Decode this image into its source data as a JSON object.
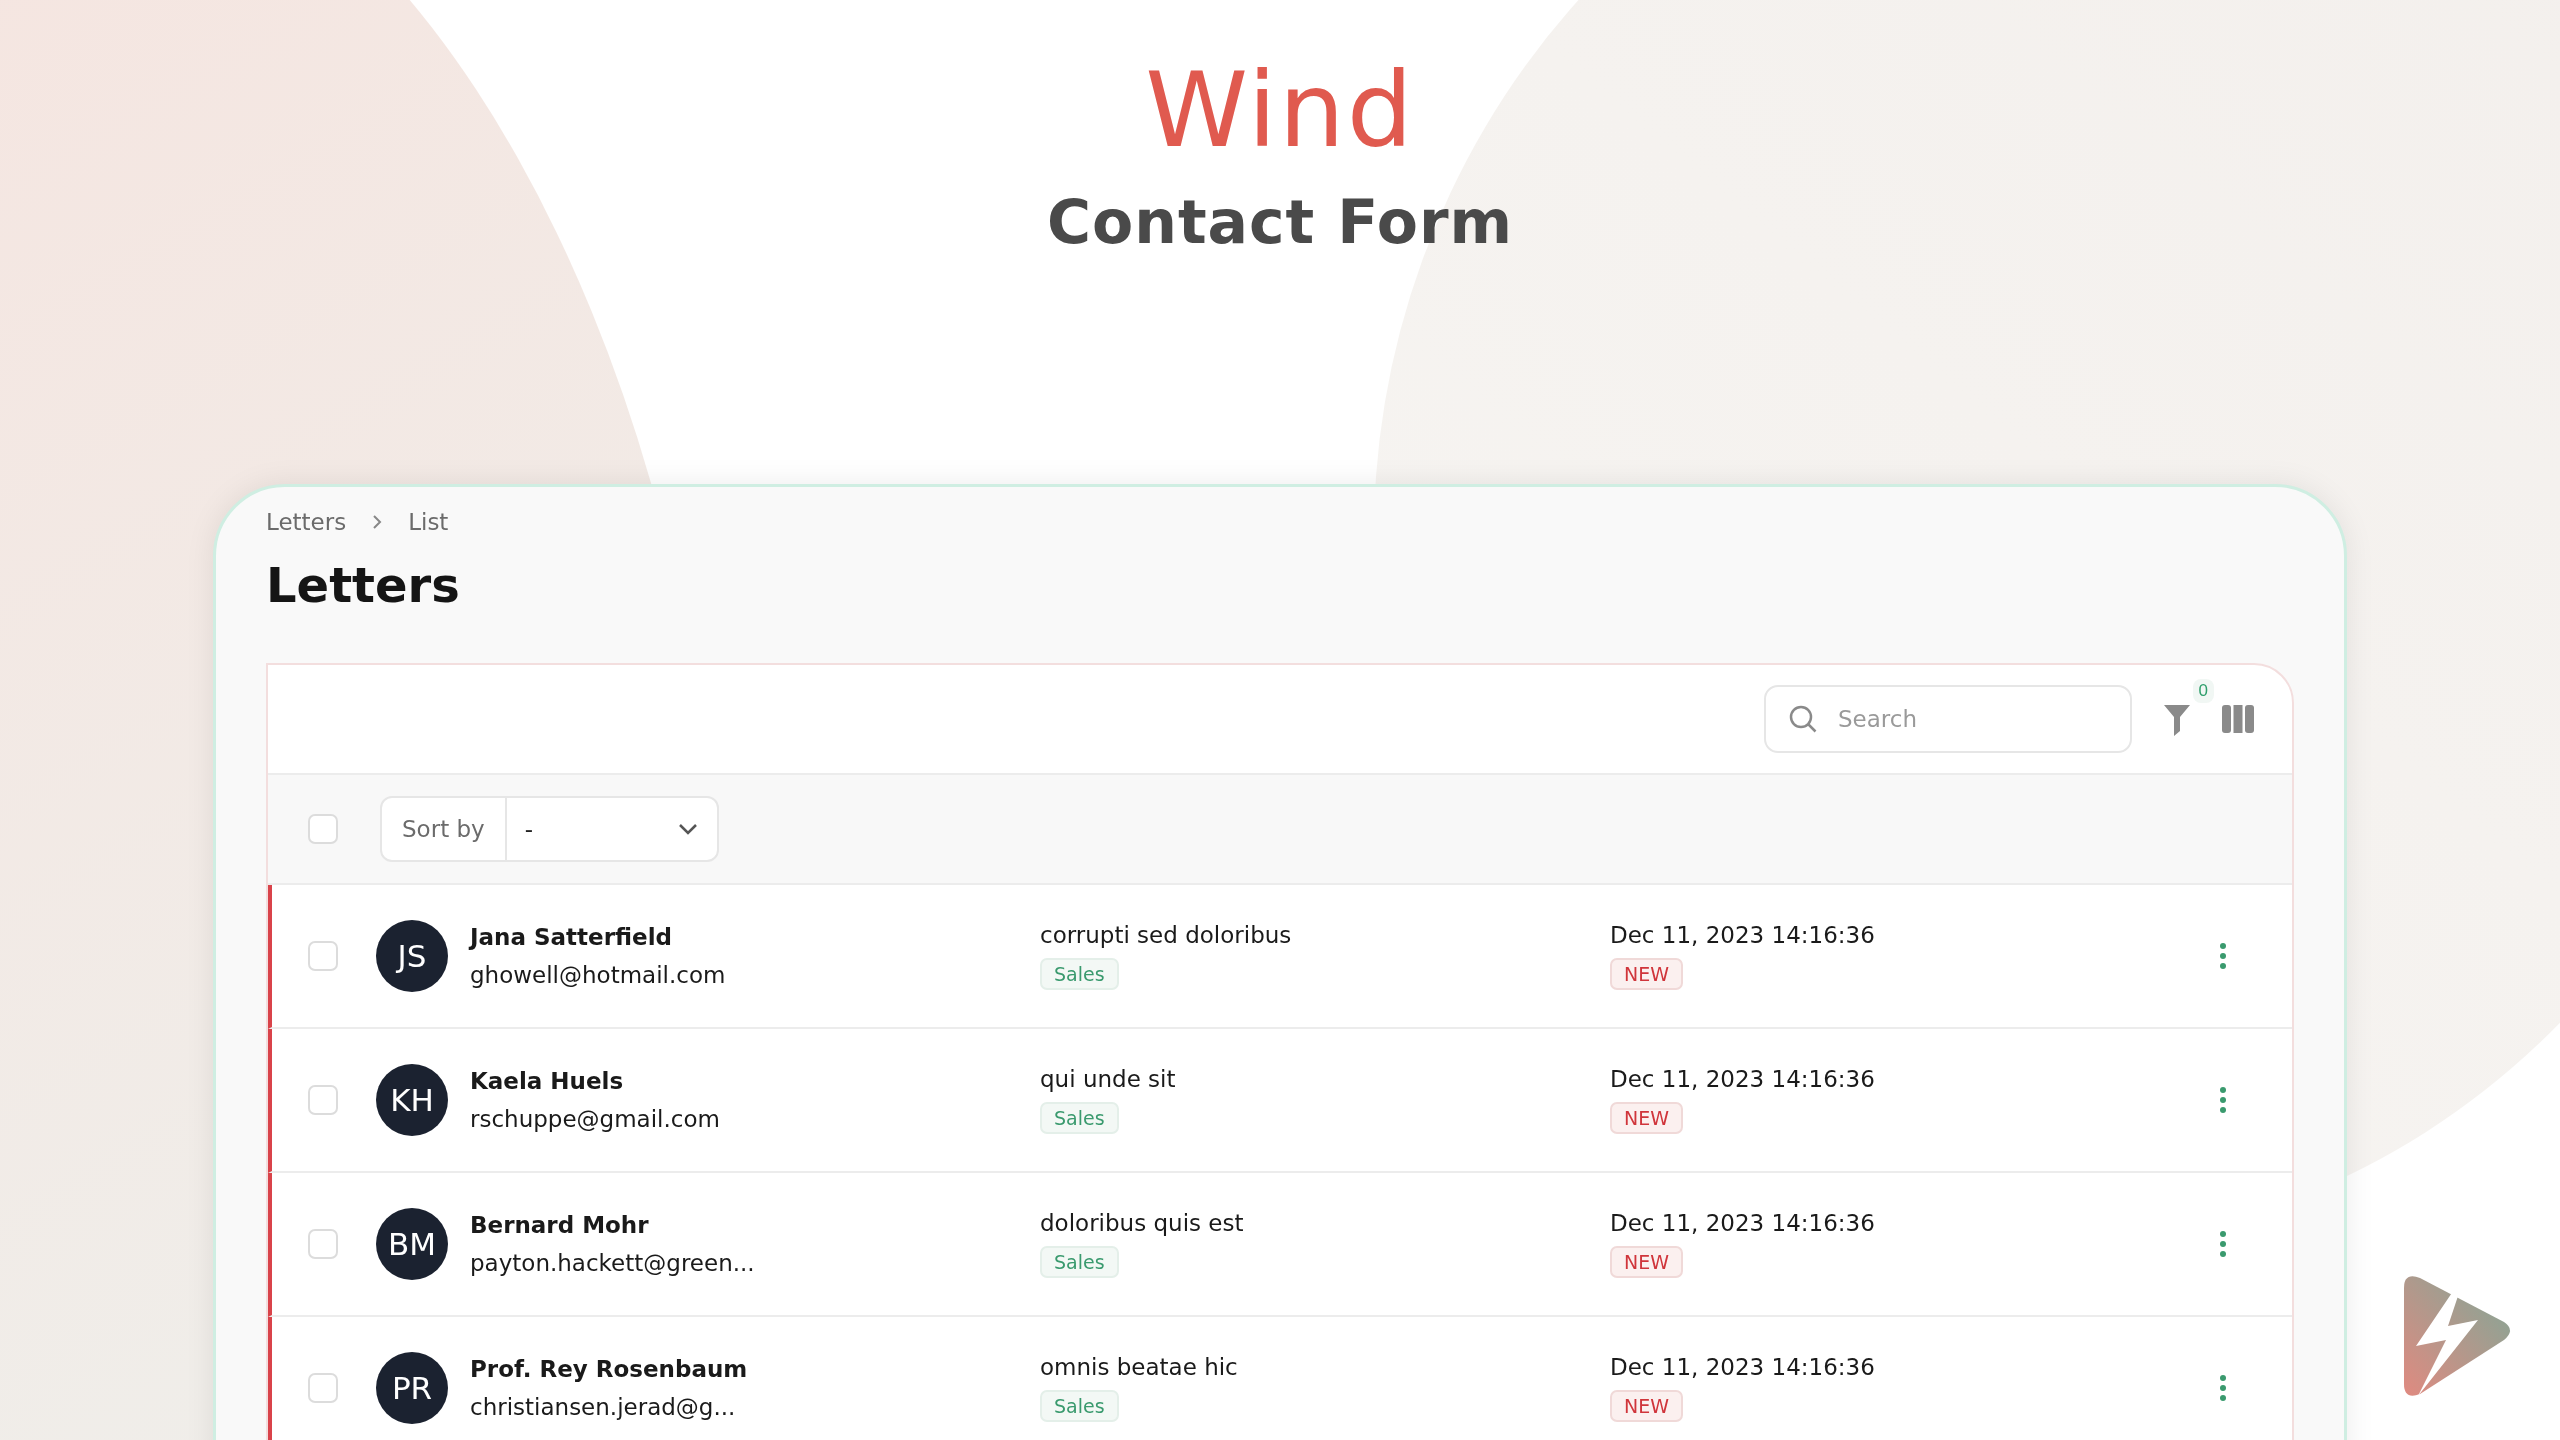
{
  "brand": {
    "title": "Wind",
    "subtitle": "Contact Form"
  },
  "breadcrumb": [
    "Letters",
    "List"
  ],
  "page_title": "Letters",
  "toolbar": {
    "search": {
      "placeholder": "Search"
    },
    "filter_count": "0"
  },
  "list_header": {
    "checked": false,
    "sort_label": "Sort by",
    "sort_value": "-"
  },
  "rows": [
    {
      "initials": "JS",
      "name": "Jana Satterfield",
      "email": "ghowell@hotmail.com",
      "subject": "corrupti sed doloribus",
      "tag": "Sales",
      "date": "Dec 11, 2023 14:16:36",
      "status": "NEW",
      "checked": false,
      "unread": true
    },
    {
      "initials": "KH",
      "name": "Kaela Huels",
      "email": "rschuppe@gmail.com",
      "subject": "qui unde sit",
      "tag": "Sales",
      "date": "Dec 11, 2023 14:16:36",
      "status": "NEW",
      "checked": false,
      "unread": true
    },
    {
      "initials": "BM",
      "name": "Bernard Mohr",
      "email": "payton.hackett@green...",
      "subject": "doloribus quis est",
      "tag": "Sales",
      "date": "Dec 11, 2023 14:16:36",
      "status": "NEW",
      "checked": false,
      "unread": true
    },
    {
      "initials": "PR",
      "name": "Prof. Rey Rosenbaum",
      "email": "christiansen.jerad@g...",
      "subject": "omnis beatae hic",
      "tag": "Sales",
      "date": "Dec 11, 2023 14:16:36",
      "status": "NEW",
      "checked": false,
      "unread": true
    }
  ]
}
